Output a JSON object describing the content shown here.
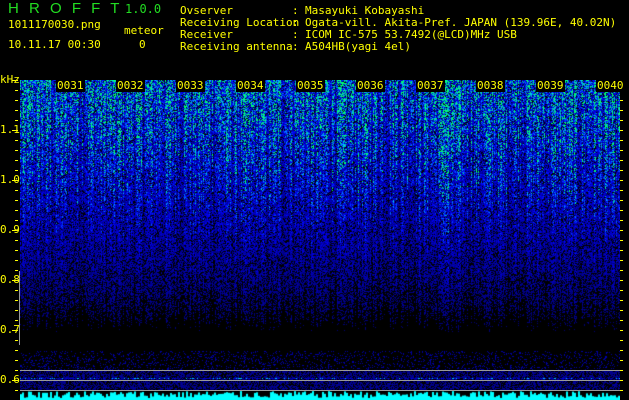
{
  "header": {
    "app_name": "H R O F F T",
    "version": "1.0.0",
    "filename": "1011170030.png",
    "datetime": "10.11.17 00:30",
    "meteor_label": "meteor",
    "meteor_count": "0"
  },
  "info": [
    {
      "label": "Ovserver",
      "value": "Masayuki Kobayashi"
    },
    {
      "label": "Receiving Location",
      "value": "Ogata-vill. Akita-Pref. JAPAN (139.96E, 40.02N)"
    },
    {
      "label": "Receiver",
      "value": "ICOM IC-575 53.7492(@LCD)MHz USB"
    },
    {
      "label": "Receiving antenna",
      "value": "A504HB(yagi 4el)"
    }
  ],
  "axis": {
    "unit": "kHz",
    "freq_labels": [
      "1.1",
      "1.0",
      "0.9",
      "0.8",
      "0.7",
      "0.6"
    ],
    "time_labels": [
      "0031",
      "0032",
      "0033",
      "0034",
      "0035",
      "0036",
      "0037",
      "0038",
      "0039",
      "0040"
    ]
  },
  "colors": {
    "text": "#ffff00",
    "title": "#22dd22",
    "histogram": "#00ffff"
  }
}
